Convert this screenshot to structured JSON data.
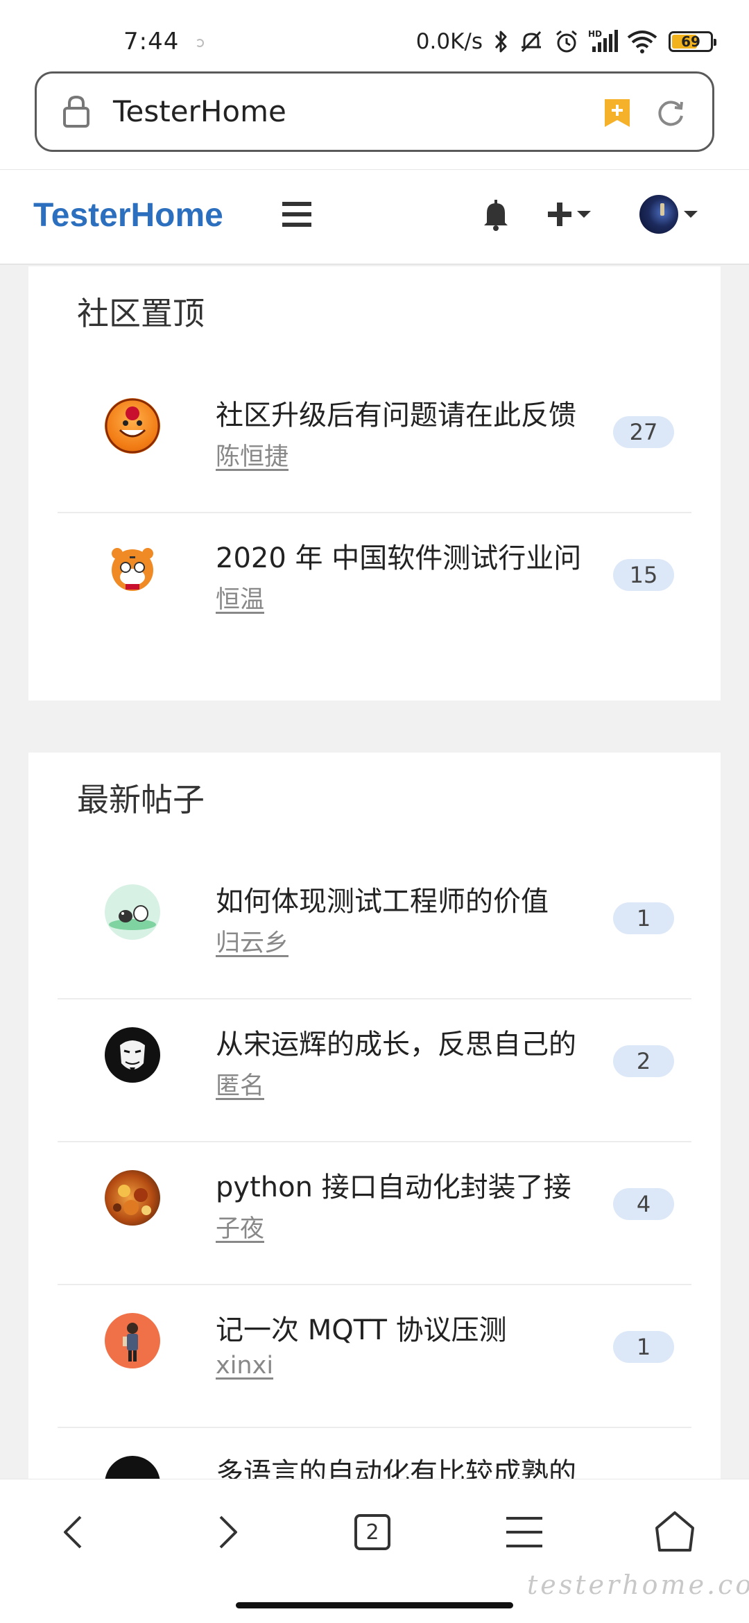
{
  "status_bar": {
    "time": "7:44",
    "net_speed": "0.0K/s",
    "battery": "69",
    "icons": [
      "bluetooth-icon",
      "mute-icon",
      "alarm-icon",
      "hd-signal-icon",
      "wifi-icon",
      "battery-icon"
    ]
  },
  "browser": {
    "address": "TesterHome",
    "icons": [
      "lock-icon",
      "bookmark-icon",
      "reload-icon"
    ]
  },
  "header": {
    "brand": "TesterHome",
    "icons": [
      "menu-icon",
      "bell-icon",
      "plus-icon",
      "avatar"
    ]
  },
  "pinned": {
    "title": "社区置顶",
    "topics": [
      {
        "title": "社区升级后有问题请在此反馈",
        "author": "陈恒捷",
        "count": "27"
      },
      {
        "title": "2020 年 中国软件测试行业问",
        "author": "恒温",
        "count": "15"
      }
    ]
  },
  "latest": {
    "title": "最新帖子",
    "topics": [
      {
        "title": "如何体现测试工程师的价值",
        "author": "归云乡",
        "count": "1"
      },
      {
        "title": "从宋运辉的成长，反思自己的",
        "author": "匿名",
        "count": "2"
      },
      {
        "title": "python 接口自动化封装了接",
        "author": "子夜",
        "count": "4"
      },
      {
        "title": "记一次 MQTT 协议压测",
        "author": "xinxi",
        "count": "1"
      },
      {
        "title": "多语言的自动化有比较成熟的",
        "author": "",
        "count": ""
      }
    ]
  },
  "bottom_nav": {
    "tabs_count": "2",
    "watermark": "testerhome.com"
  }
}
